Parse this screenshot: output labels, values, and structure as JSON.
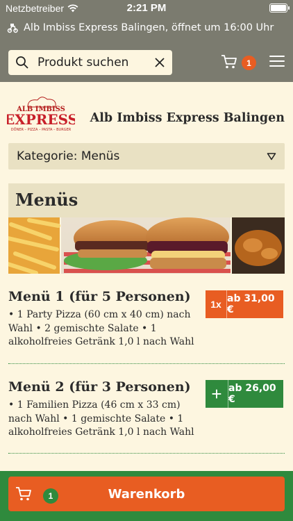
{
  "status_bar": {
    "carrier": "Netzbetreiber",
    "time": "2:21 PM"
  },
  "notice": {
    "text": "Alb Imbiss Express Balingen, öffnet um 16:00 Uhr",
    "icon": "moped-icon"
  },
  "search": {
    "placeholder": "Produkt suchen"
  },
  "cart": {
    "count": "1"
  },
  "logo": {
    "line1": "ALB IMBISS",
    "line2": "EXPRESS",
    "tagline": "DÖNER – PIZZA – PASTA – BURGER"
  },
  "store": {
    "title": "Alb Imbiss Express Balingen"
  },
  "category": {
    "label": "Kategorie: Menüs"
  },
  "section": {
    "title": "Menüs"
  },
  "items": [
    {
      "name": "Menü 1 (für 5 Personen)",
      "desc": "• 1 Party Pizza (60 cm x 40 cm) nach Wahl • 2 gemischte Salate • 1 alkoholfreies Getränk 1,0 l nach Wahl",
      "qty": "1x",
      "price": "ab 31,00 €"
    },
    {
      "name": "Menü 2 (für 3 Personen)",
      "desc": "• 1 Familien Pizza (46 cm x 33 cm) nach Wahl • 1 gemischte Salate • 1 alkoholfreies Getränk 1,0 l nach Wahl",
      "qty": "+",
      "price": "ab 26,00 €"
    }
  ],
  "bottom": {
    "cart_label": "Warenkorb",
    "cart_count": "1"
  },
  "colors": {
    "header": "#7b7b6f",
    "background": "#fdf6e0",
    "accent_orange": "#e85d22",
    "accent_green": "#2f8a3d",
    "panel": "#e9e1c3"
  }
}
